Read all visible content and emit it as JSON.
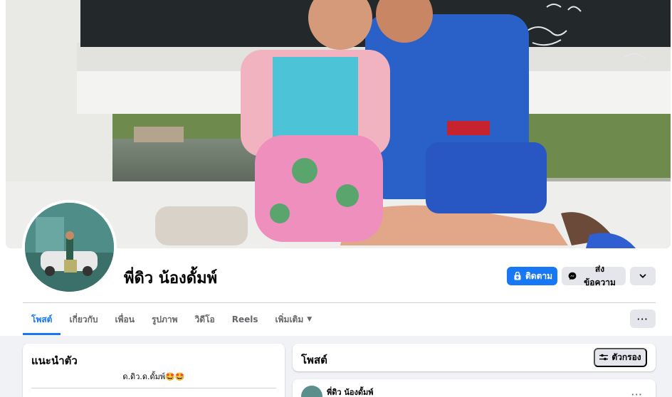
{
  "profile": {
    "name": "พี่ดิว น้องดั้มพ์"
  },
  "actions": {
    "follow_label": "ติดตาม",
    "message_label": "ส่งข้อความ",
    "follow_icon": "lock-plus-icon",
    "message_icon": "messenger-icon",
    "more_icon": "chevron-down-icon"
  },
  "tabs": [
    {
      "label": "โพสต์",
      "active": true
    },
    {
      "label": "เกี่ยวกับ",
      "active": false
    },
    {
      "label": "เพื่อน",
      "active": false
    },
    {
      "label": "รูปภาพ",
      "active": false
    },
    {
      "label": "วิดีโอ",
      "active": false
    },
    {
      "label": "Reels",
      "active": false
    },
    {
      "label": "เพิ่มเติม",
      "active": false
    }
  ],
  "tab_more_button": "···",
  "intro": {
    "title": "แนะนำตัว",
    "bio": "ด.ดิว.ด.ดั้มพ์🤩🤩"
  },
  "posts_section": {
    "title": "โพสต์",
    "filter_label": "ตัวกรอง"
  },
  "post": {
    "author": "พี่ดิว น้องดั้มพ์",
    "more": "···"
  },
  "colors": {
    "accent": "#1877f2",
    "background": "#f0f2f5",
    "button_gray": "#e4e6eb",
    "muted_text": "#65676b"
  }
}
